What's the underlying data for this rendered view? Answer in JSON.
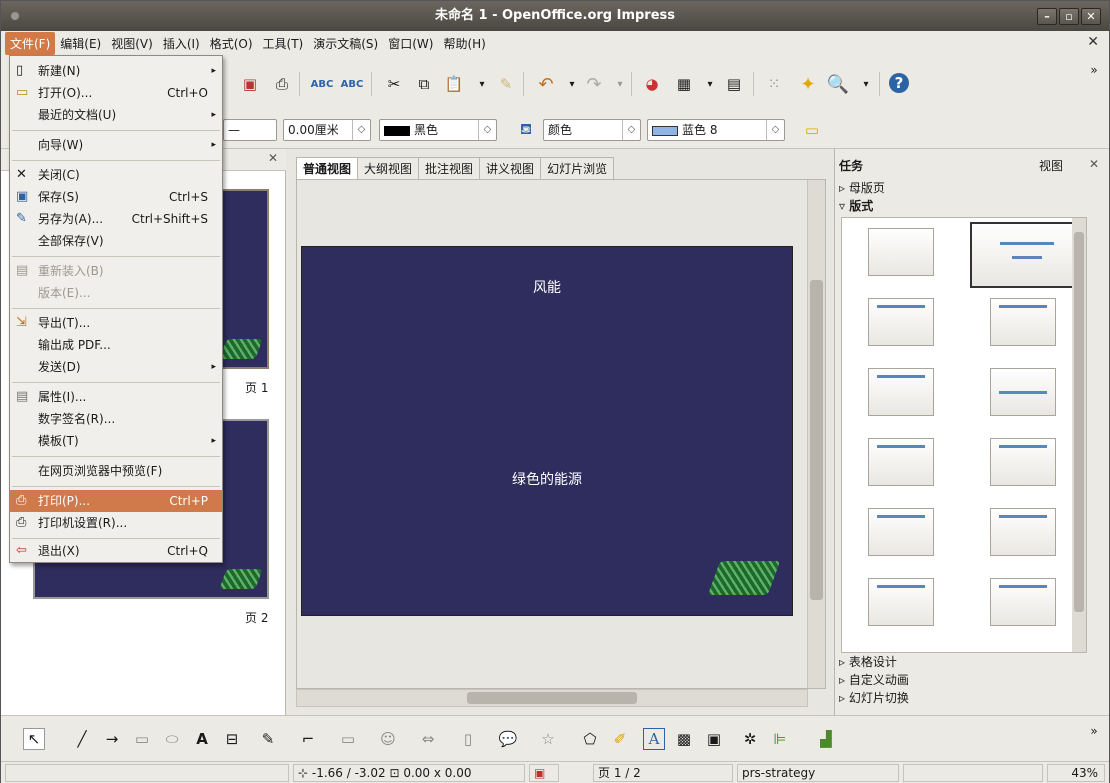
{
  "window": {
    "title": "未命名 1 - OpenOffice.org Impress"
  },
  "menubar": [
    "文件(F)",
    "编辑(E)",
    "视图(V)",
    "插入(I)",
    "格式(O)",
    "工具(T)",
    "演示文稿(S)",
    "窗口(W)",
    "帮助(H)"
  ],
  "file_menu": [
    {
      "label": "新建(N)",
      "shortcut": "",
      "submenu": true,
      "icon": "new-doc-icon"
    },
    {
      "label": "打开(O)...",
      "shortcut": "Ctrl+O",
      "icon": "open-folder-icon"
    },
    {
      "label": "最近的文档(U)",
      "shortcut": "",
      "submenu": true
    },
    {
      "label": "向导(W)",
      "shortcut": "",
      "submenu": true
    },
    {
      "label": "关闭(C)",
      "shortcut": "",
      "icon": "close-x-icon"
    },
    {
      "label": "保存(S)",
      "shortcut": "Ctrl+S",
      "icon": "save-icon"
    },
    {
      "label": "另存为(A)...",
      "shortcut": "Ctrl+Shift+S",
      "icon": "save-as-icon"
    },
    {
      "label": "全部保存(V)",
      "shortcut": ""
    },
    {
      "label": "重新装入(B)",
      "shortcut": "",
      "disabled": true
    },
    {
      "label": "版本(E)...",
      "shortcut": "",
      "disabled": true
    },
    {
      "label": "导出(T)...",
      "shortcut": "",
      "icon": "export-icon"
    },
    {
      "label": "输出成 PDF...",
      "shortcut": ""
    },
    {
      "label": "发送(D)",
      "shortcut": "",
      "submenu": true
    },
    {
      "label": "属性(I)...",
      "shortcut": "",
      "icon": "properties-icon"
    },
    {
      "label": "数字签名(R)...",
      "shortcut": ""
    },
    {
      "label": "模板(T)",
      "shortcut": "",
      "submenu": true
    },
    {
      "label": "在网页浏览器中预览(F)",
      "shortcut": ""
    },
    {
      "label": "打印(P)...",
      "shortcut": "Ctrl+P",
      "highlighted": true,
      "icon": "printer-icon"
    },
    {
      "label": "打印机设置(R)...",
      "shortcut": "",
      "icon": "printer-settings-icon"
    },
    {
      "label": "退出(X)",
      "shortcut": "Ctrl+Q",
      "icon": "exit-icon"
    }
  ],
  "format_bar": {
    "line_width": "0.00厘米",
    "line_color": "黑色",
    "area_style": "颜色",
    "area_color": "蓝色 8"
  },
  "view_tabs": [
    "普通视图",
    "大纲视图",
    "批注视图",
    "讲义视图",
    "幻灯片浏览"
  ],
  "slide": {
    "title": "风能",
    "subtitle": "绿色的能源"
  },
  "slides_pane": {
    "page1": "页 1",
    "page2": "页 2"
  },
  "tasks": {
    "title": "任务",
    "view": "视图",
    "master": "母版页",
    "layouts": "版式",
    "table_design": "表格设计",
    "custom_anim": "自定义动画",
    "transition": "幻灯片切换"
  },
  "status": {
    "position": "-1.66 / -3.02",
    "size": "0.00 x 0.00",
    "page": "页 1 / 2",
    "master": "prs-strategy",
    "zoom": "43%"
  },
  "colors": {
    "slide_bg": "#2e2d5e",
    "highlight": "#d0794a",
    "titlebar": "#4a4741"
  }
}
